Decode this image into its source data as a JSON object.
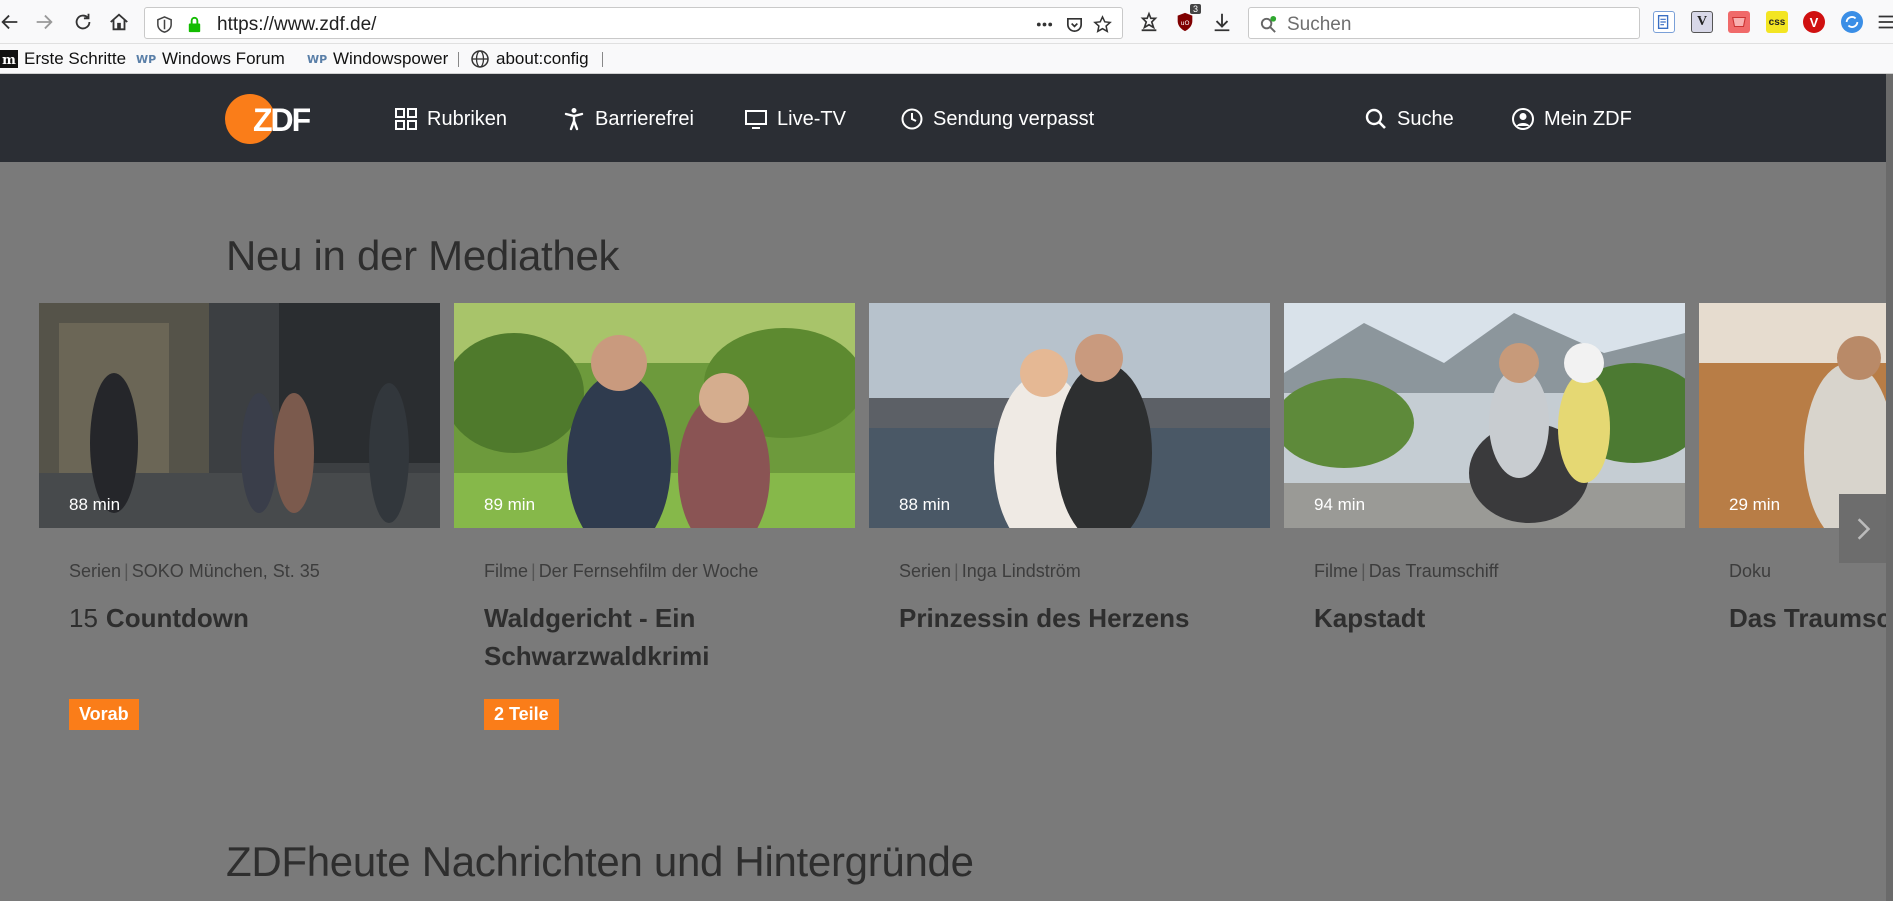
{
  "browser": {
    "url": "https://www.zdf.de/",
    "search_placeholder": "Suchen",
    "ublock_count": "3",
    "ext_css_label": "css",
    "ext_v_label": "V",
    "bookmarks": [
      {
        "label": "Erste Schritte",
        "icon": "m-icon"
      },
      {
        "label": "Windows Forum",
        "icon": "wp-icon"
      },
      {
        "label": "Windowspower",
        "icon": "wp-icon"
      },
      {
        "label": "about:config",
        "icon": "globe-icon"
      }
    ]
  },
  "header": {
    "logo": "ZDF",
    "nav": [
      {
        "label": "Rubriken",
        "icon": "grid-icon"
      },
      {
        "label": "Barrierefrei",
        "icon": "accessibility-icon"
      },
      {
        "label": "Live-TV",
        "icon": "tv-icon"
      },
      {
        "label": "Sendung verpasst",
        "icon": "clock-icon"
      }
    ],
    "search_label": "Suche",
    "account_label": "Mein ZDF"
  },
  "sections": {
    "mediathek_title": "Neu in der Mediathek",
    "news_title": "ZDFheute Nachrichten und Hintergründe"
  },
  "cards": [
    {
      "duration": "88 min",
      "category": "Serien",
      "series": "SOKO München, St. 35",
      "number": "15",
      "title": "Countdown",
      "badge": "Vorab"
    },
    {
      "duration": "89 min",
      "category": "Filme",
      "series": "Der Fernsehfilm der Woche",
      "number": "",
      "title": "Waldgericht - Ein Schwarzwaldkrimi",
      "badge": "2 Teile"
    },
    {
      "duration": "88 min",
      "category": "Serien",
      "series": "Inga Lindström",
      "number": "",
      "title": "Prinzessin des Herzens",
      "badge": ""
    },
    {
      "duration": "94 min",
      "category": "Filme",
      "series": "Das Traumschiff",
      "number": "",
      "title": "Kapstadt",
      "badge": ""
    },
    {
      "duration": "29 min",
      "category": "Doku",
      "series": "",
      "number": "",
      "title": "Das Traumschiff Kapstadt",
      "badge": ""
    }
  ],
  "colors": {
    "accent": "#fa7d19",
    "header_bg": "#2b2e34",
    "overlay_bg": "#7a7a7a"
  }
}
